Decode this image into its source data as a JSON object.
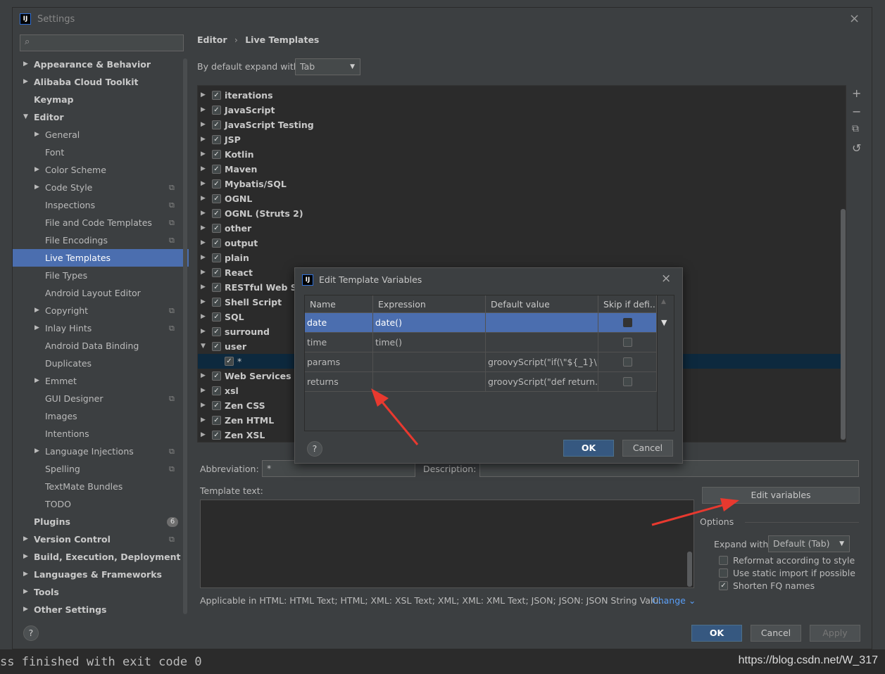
{
  "console": {
    "text": "ss finished with exit code 0"
  },
  "watermark": "https://blog.csdn.net/W_317",
  "window": {
    "title": "Settings",
    "logo": "IJ",
    "close": "×"
  },
  "sidebar": {
    "search_placeholder": "",
    "items": [
      {
        "label": "Appearance & Behavior",
        "level": 0,
        "arrow": "▶",
        "bold": true
      },
      {
        "label": "Alibaba Cloud Toolkit",
        "level": 0,
        "arrow": "▶",
        "bold": true
      },
      {
        "label": "Keymap",
        "level": 0,
        "arrow": "",
        "bold": true
      },
      {
        "label": "Editor",
        "level": 0,
        "arrow": "▼",
        "bold": true
      },
      {
        "label": "General",
        "level": 1,
        "arrow": "▶"
      },
      {
        "label": "Font",
        "level": 1,
        "arrow": ""
      },
      {
        "label": "Color Scheme",
        "level": 1,
        "arrow": "▶"
      },
      {
        "label": "Code Style",
        "level": 1,
        "arrow": "▶",
        "copy": true
      },
      {
        "label": "Inspections",
        "level": 1,
        "arrow": "",
        "copy": true
      },
      {
        "label": "File and Code Templates",
        "level": 1,
        "arrow": "",
        "copy": true
      },
      {
        "label": "File Encodings",
        "level": 1,
        "arrow": "",
        "copy": true
      },
      {
        "label": "Live Templates",
        "level": 1,
        "arrow": "",
        "selected": true
      },
      {
        "label": "File Types",
        "level": 1,
        "arrow": ""
      },
      {
        "label": "Android Layout Editor",
        "level": 1,
        "arrow": ""
      },
      {
        "label": "Copyright",
        "level": 1,
        "arrow": "▶",
        "copy": true
      },
      {
        "label": "Inlay Hints",
        "level": 1,
        "arrow": "▶",
        "copy": true
      },
      {
        "label": "Android Data Binding",
        "level": 1,
        "arrow": ""
      },
      {
        "label": "Duplicates",
        "level": 1,
        "arrow": ""
      },
      {
        "label": "Emmet",
        "level": 1,
        "arrow": "▶"
      },
      {
        "label": "GUI Designer",
        "level": 1,
        "arrow": "",
        "copy": true
      },
      {
        "label": "Images",
        "level": 1,
        "arrow": ""
      },
      {
        "label": "Intentions",
        "level": 1,
        "arrow": ""
      },
      {
        "label": "Language Injections",
        "level": 1,
        "arrow": "▶",
        "copy": true
      },
      {
        "label": "Spelling",
        "level": 1,
        "arrow": "",
        "copy": true
      },
      {
        "label": "TextMate Bundles",
        "level": 1,
        "arrow": ""
      },
      {
        "label": "TODO",
        "level": 1,
        "arrow": ""
      },
      {
        "label": "Plugins",
        "level": 0,
        "arrow": "",
        "bold": true,
        "badge": "6"
      },
      {
        "label": "Version Control",
        "level": 0,
        "arrow": "▶",
        "bold": true,
        "copy": true
      },
      {
        "label": "Build, Execution, Deployment",
        "level": 0,
        "arrow": "▶",
        "bold": true
      },
      {
        "label": "Languages & Frameworks",
        "level": 0,
        "arrow": "▶",
        "bold": true
      },
      {
        "label": "Tools",
        "level": 0,
        "arrow": "▶",
        "bold": true
      },
      {
        "label": "Other Settings",
        "level": 0,
        "arrow": "▶",
        "bold": true
      }
    ]
  },
  "breadcrumb": {
    "part1": "Editor",
    "sep": "›",
    "part2": "Live Templates"
  },
  "expand_default": {
    "label": "By default expand with",
    "value": "Tab"
  },
  "tree": {
    "rows": [
      {
        "label": "iterations",
        "arrow": "▶",
        "checked": true
      },
      {
        "label": "JavaScript",
        "arrow": "▶",
        "checked": true
      },
      {
        "label": "JavaScript Testing",
        "arrow": "▶",
        "checked": true
      },
      {
        "label": "JSP",
        "arrow": "▶",
        "checked": true
      },
      {
        "label": "Kotlin",
        "arrow": "▶",
        "checked": true
      },
      {
        "label": "Maven",
        "arrow": "▶",
        "checked": true
      },
      {
        "label": "Mybatis/SQL",
        "arrow": "▶",
        "checked": true
      },
      {
        "label": "OGNL",
        "arrow": "▶",
        "checked": true
      },
      {
        "label": "OGNL (Struts 2)",
        "arrow": "▶",
        "checked": true
      },
      {
        "label": "other",
        "arrow": "▶",
        "checked": true
      },
      {
        "label": "output",
        "arrow": "▶",
        "checked": true
      },
      {
        "label": "plain",
        "arrow": "▶",
        "checked": true
      },
      {
        "label": "React",
        "arrow": "▶",
        "checked": true
      },
      {
        "label": "RESTful Web Ser",
        "arrow": "▶",
        "checked": true
      },
      {
        "label": "Shell Script",
        "arrow": "▶",
        "checked": true
      },
      {
        "label": "SQL",
        "arrow": "▶",
        "checked": true
      },
      {
        "label": "surround",
        "arrow": "▶",
        "checked": true
      },
      {
        "label": "user",
        "arrow": "▼",
        "checked": true
      },
      {
        "label": "*",
        "arrow": "",
        "checked": true,
        "child": true,
        "selected": true
      },
      {
        "label": "Web Services",
        "arrow": "▶",
        "checked": true
      },
      {
        "label": "xsl",
        "arrow": "▶",
        "checked": true
      },
      {
        "label": "Zen CSS",
        "arrow": "▶",
        "checked": true
      },
      {
        "label": "Zen HTML",
        "arrow": "▶",
        "checked": true
      },
      {
        "label": "Zen XSL",
        "arrow": "▶",
        "checked": true
      }
    ]
  },
  "toolbar": {
    "add": "+",
    "remove": "−",
    "copy": "⧉",
    "restore": "↺"
  },
  "abbreviation": {
    "label": "Abbreviation:",
    "value": "*"
  },
  "description": {
    "label": "Description:",
    "value": ""
  },
  "template_text": {
    "label": "Template text:",
    "value": ""
  },
  "applicable": {
    "text": "Applicable in HTML: HTML Text; HTML; XML: XSL Text; XML; XML: XML Text; JSON; JSON: JSON String Valu...",
    "change": "Change ⌄"
  },
  "edit_variables_label": "Edit variables",
  "options": {
    "title": "Options",
    "expand_with_label": "Expand with",
    "expand_with_value": "Default (Tab)",
    "reformat": {
      "label": "Reformat according to style",
      "checked": false
    },
    "static_import": {
      "label": "Use static import if possible",
      "checked": false
    },
    "shorten_fq": {
      "label": "Shorten FQ names",
      "checked": true
    }
  },
  "buttons": {
    "help": "?",
    "ok": "OK",
    "cancel": "Cancel",
    "apply": "Apply"
  },
  "dialog": {
    "title": "Edit Template Variables",
    "close": "×",
    "columns": [
      "Name",
      "Expression",
      "Default value",
      "Skip if defi..."
    ],
    "rows": [
      {
        "name": "date",
        "expression": "date()",
        "default": "",
        "skip": false,
        "selected": true
      },
      {
        "name": "time",
        "expression": "time()",
        "default": "",
        "skip": false
      },
      {
        "name": "params",
        "expression": "",
        "default": "groovyScript(\"if(\\\"${_1}\\\"....",
        "skip": false
      },
      {
        "name": "returns",
        "expression": "",
        "default": "groovyScript(\"def return...",
        "skip": false
      }
    ],
    "help": "?",
    "ok": "OK",
    "cancel": "Cancel"
  },
  "colors": {
    "accent": "#4b6eaf",
    "annotation": "#e8392f",
    "background": "#3c3f41"
  }
}
